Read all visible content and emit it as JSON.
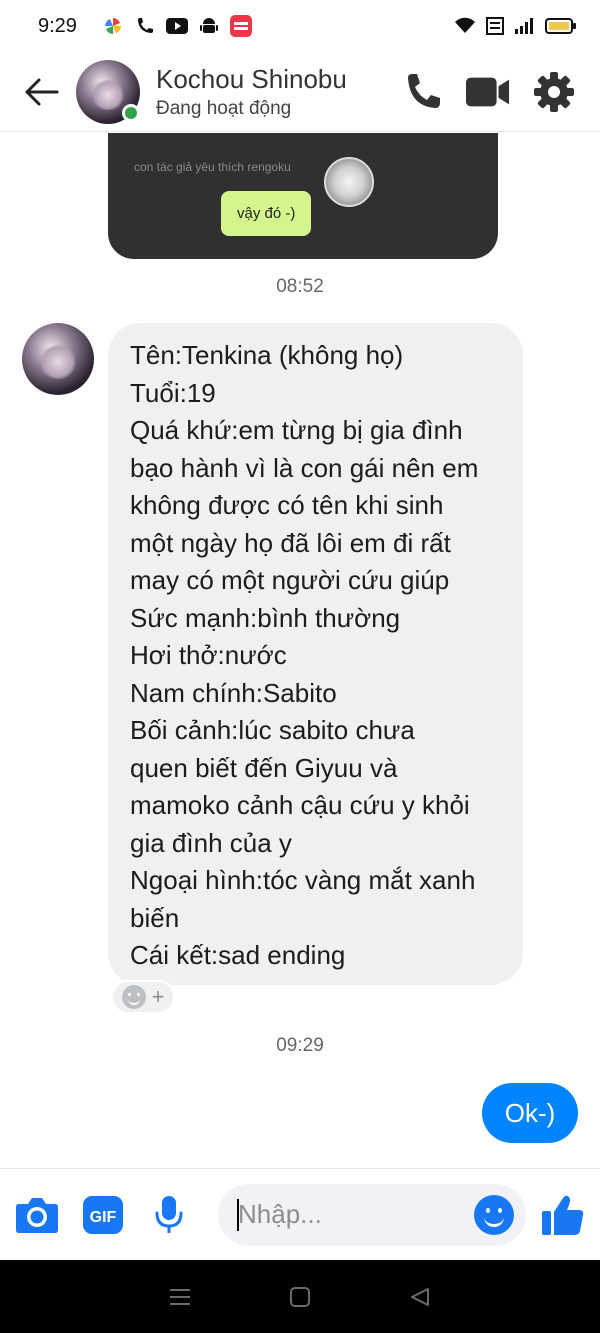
{
  "status_bar": {
    "time": "9:29",
    "left_icons": [
      "pinwheel-app-icon",
      "missed-call-icon",
      "youtube-icon",
      "android-icon",
      "mangatoon-icon"
    ],
    "right_icons": [
      "wifi-icon",
      "volte-icon",
      "signal-icon",
      "battery-icon"
    ]
  },
  "header": {
    "contact_name": "Kochou Shinobu",
    "contact_status": "Đang hoạt động",
    "online": true
  },
  "shared_image": {
    "caption": "con tác giả yêu thích rengoku",
    "bubble_text": "vậy đó -)"
  },
  "messages": {
    "timestamp_1": "08:52",
    "incoming_lines": [
      "Tên:Tenkina (không họ)",
      "Tuổi:19",
      "Quá khứ:em từng bị gia đình",
      "bạo hành vì là con gái nên em",
      "không được có tên khi sinh",
      "một ngày họ đã lôi em đi rất",
      "may có một người cứu giúp",
      "Sức mạnh:bình thường",
      "Hơi thở:nước",
      "Nam chính:Sabito",
      "Bối cảnh:lúc sabito chưa",
      "quen biết đến Giyuu và",
      "mamoko cảnh cậu cứu y khỏi",
      "gia đình của y",
      "Ngoại hình:tóc vàng mắt xanh",
      "biến",
      "Cái kết:sad ending"
    ],
    "reaction_plus": "+",
    "timestamp_2": "09:29",
    "outgoing_text": "Ok-)"
  },
  "composer": {
    "placeholder": "Nhập...",
    "value": "",
    "gif_label": "GIF"
  },
  "colors": {
    "accent": "#1877f2",
    "outgoing_bubble": "#0084ff",
    "incoming_bubble": "#f0f0f0",
    "online": "#31a24c"
  }
}
